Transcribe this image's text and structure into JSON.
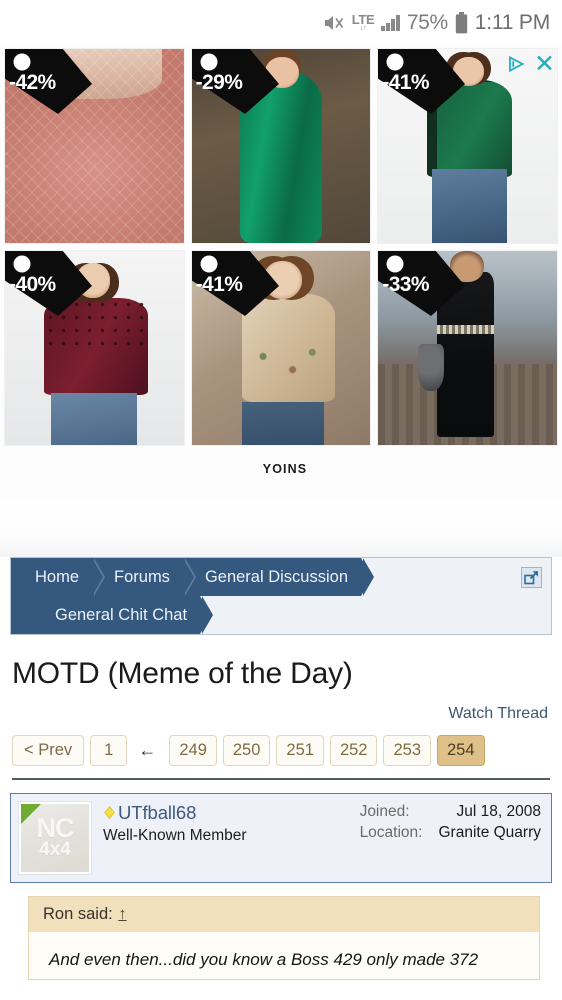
{
  "status_bar": {
    "mute_icon": "volume-mute-icon",
    "network_label": "LTE",
    "network_sub": "↓↑",
    "signal_icon": "signal-bars-icon",
    "battery_pct": "75%",
    "battery_icon": "battery-icon",
    "time": "1:11 PM"
  },
  "advertisement": {
    "brand": "YOINS",
    "adchoices_icon": "adchoices-icon",
    "close_icon": "close-icon",
    "items": [
      {
        "discount": "-42%",
        "alt": "pink textured leggings"
      },
      {
        "discount": "-29%",
        "alt": "green satin wrap dress"
      },
      {
        "discount": "-41%",
        "alt": "green lace shoulder top"
      },
      {
        "discount": "-40%",
        "alt": "maroon polka dot mesh top"
      },
      {
        "discount": "-41%",
        "alt": "beige floral peplum top"
      },
      {
        "discount": "-33%",
        "alt": "black maxi dress"
      }
    ]
  },
  "breadcrumb": {
    "row1": [
      "Home",
      "Forums",
      "General Discussion"
    ],
    "row2": [
      "General Chit Chat"
    ],
    "popup_icon": "external-link-icon",
    "accent_color": "#35587f"
  },
  "thread": {
    "title": "MOTD (Meme of the Day)",
    "watch_label": "Watch Thread"
  },
  "pagination": {
    "prev_label": "< Prev",
    "first_page": "1",
    "jump_arrow": "←",
    "pages": [
      "249",
      "250",
      "251",
      "252",
      "253",
      "254"
    ],
    "active_page": "254",
    "active_color": "#dfc088"
  },
  "post": {
    "avatar": {
      "icon": "user-avatar",
      "line1": "NC",
      "line2": "4x4",
      "online_corner_color": "#6eab2f"
    },
    "badge_icon": "diamond-badge-icon",
    "username": "UTfball68",
    "user_title": "Well-Known Member",
    "meta": [
      {
        "key": "Joined:",
        "value": "Jul 18, 2008"
      },
      {
        "key": "Location:",
        "value": "Granite Quarry"
      }
    ]
  },
  "quote": {
    "header": "Ron said:",
    "jump_glyph": "↑",
    "body": "And even then...did you know a Boss 429 only made 372"
  }
}
